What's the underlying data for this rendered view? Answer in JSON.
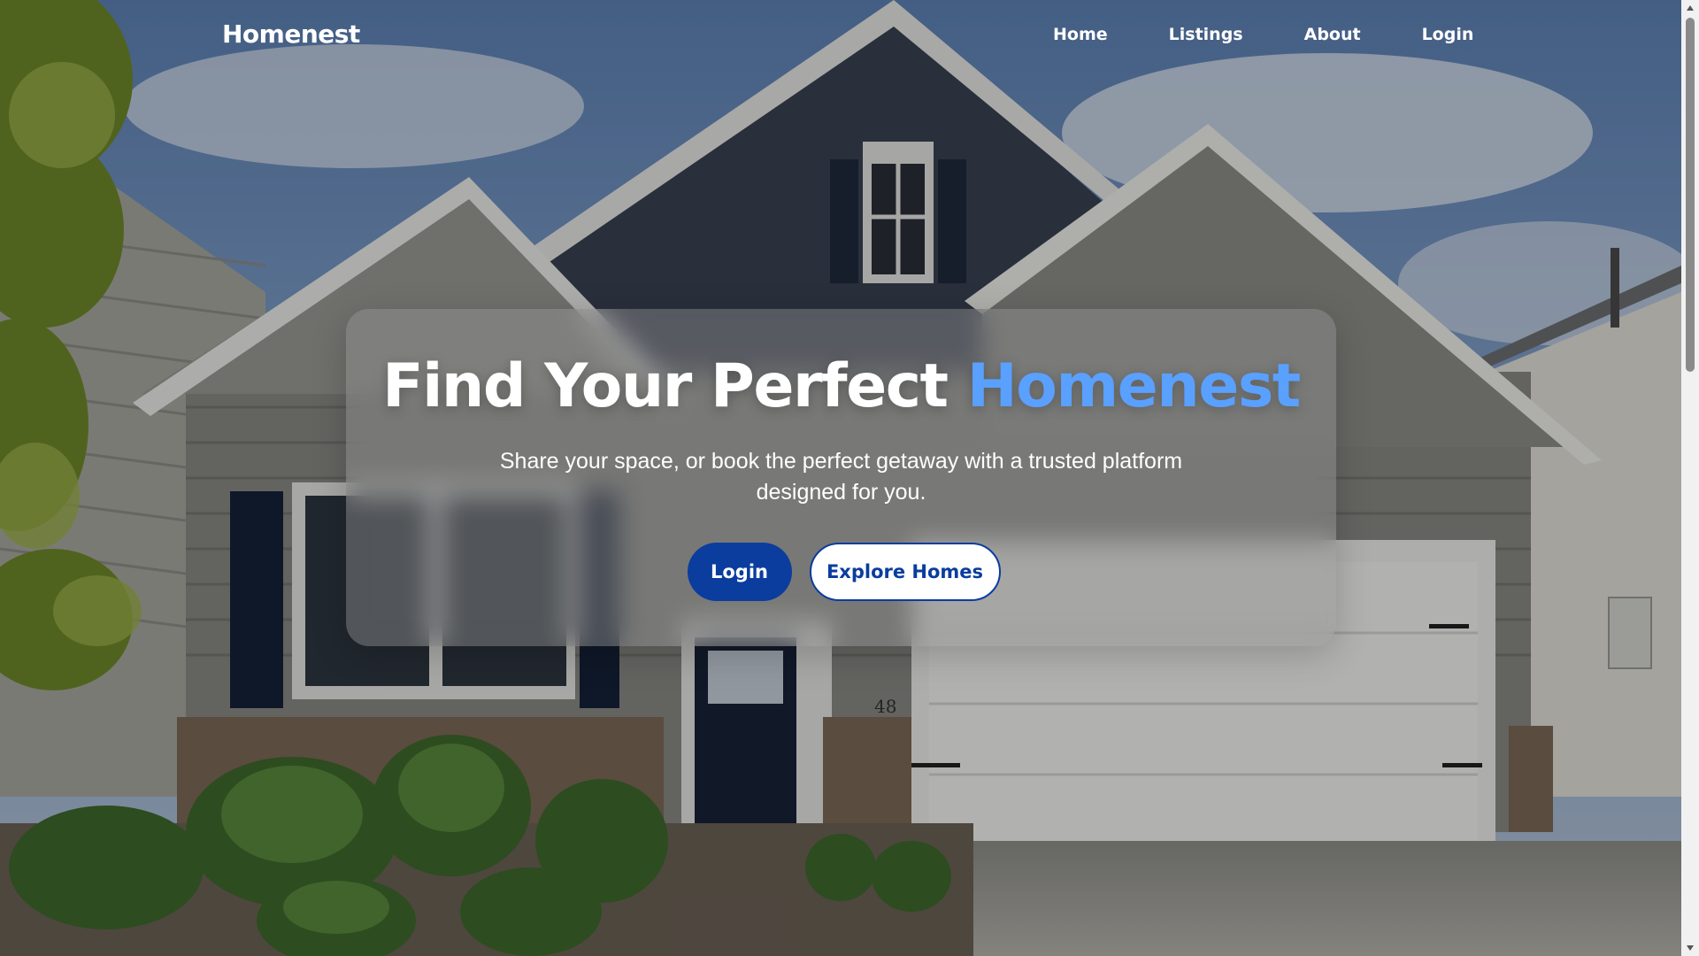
{
  "brand": {
    "name": "Homenest"
  },
  "nav": {
    "items": [
      {
        "label": "Home"
      },
      {
        "label": "Listings"
      },
      {
        "label": "About"
      },
      {
        "label": "Login"
      }
    ]
  },
  "hero": {
    "title_main": "Find Your Perfect ",
    "title_accent": "Homenest",
    "subtitle": "Share your space, or book the perfect getaway with a trusted platform designed for you.",
    "primary_button": "Login",
    "secondary_button": "Explore Homes",
    "background_image": "suburban-house-photo"
  },
  "colors": {
    "accent": "#5aa0ff",
    "primary_button": "#0a3d9e",
    "secondary_button_bg": "#ffffff",
    "text": "#ffffff"
  },
  "icons": {
    "scroll_up": "scroll-up-arrow-icon",
    "scroll_down": "scroll-down-arrow-icon"
  }
}
